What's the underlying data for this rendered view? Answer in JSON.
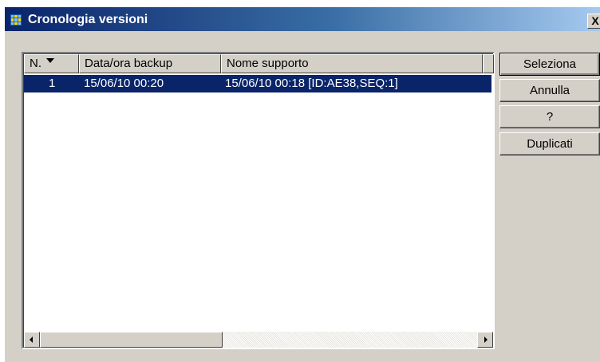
{
  "window": {
    "title": "Cronologia versioni",
    "close_label": "X"
  },
  "list": {
    "columns": [
      {
        "label": "N.",
        "sort": "descending"
      },
      {
        "label": "Data/ora backup"
      },
      {
        "label": "Nome supporto"
      }
    ],
    "rows": [
      {
        "n": "1",
        "backup_datetime": "15/06/10 00:20",
        "media_name": "15/06/10 00:18 [ID:AE38,SEQ:1]",
        "selected": true
      }
    ]
  },
  "buttons": {
    "select": "Seleziona",
    "cancel": "Annulla",
    "help": "?",
    "duplicates": "Duplicati"
  },
  "colors": {
    "selection": "#0a246a",
    "titlebar_start": "#0a246a",
    "face": "#d4d0c8"
  }
}
